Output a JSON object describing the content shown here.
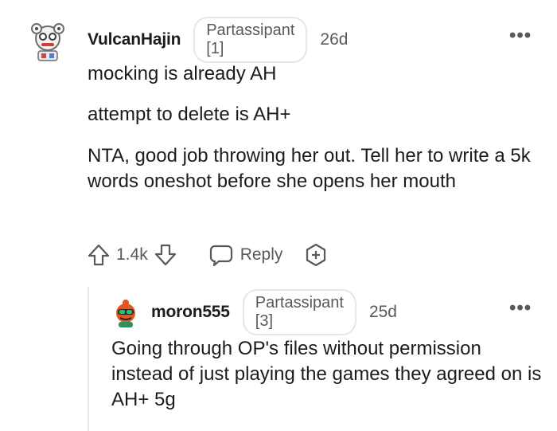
{
  "comment": {
    "username": "VulcanHajin",
    "flair": "Partassipant [1]",
    "age": "26d",
    "paragraphs": [
      "mocking is already AH",
      "attempt to delete is AH+",
      "NTA, good job throwing her out. Tell her to write a 5k words oneshot before she opens her mouth"
    ],
    "score": "1.4k",
    "reply_label": "Reply",
    "more_icon": "more-options-icon"
  },
  "reply": {
    "username": "moron555",
    "flair": "Partassipant [3]",
    "age": "25d",
    "body": "Going through OP's files without permission instead of just playing the games they agreed on is AH+ 5g"
  },
  "colors": {
    "text": "#1c1c1c",
    "muted": "#555a5e",
    "border": "#e4e6e8"
  }
}
